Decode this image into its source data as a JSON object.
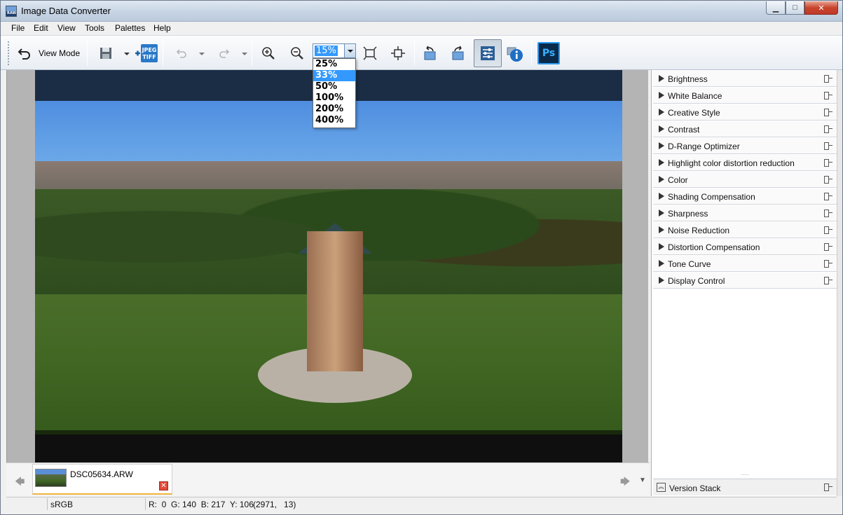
{
  "window": {
    "title": "Image Data Converter",
    "app_icon_text": "RAW",
    "minimize_glyph": "▁",
    "maximize_glyph": "□",
    "close_glyph": "✕"
  },
  "menu": [
    "File",
    "Edit",
    "View",
    "Tools",
    "Palettes",
    "Help"
  ],
  "toolbar": {
    "view_mode_label": "View Mode",
    "jpeg_tiff_icon_text": [
      "JPEG",
      "TIFF"
    ],
    "ps_icon_text": "Ps",
    "zoom": {
      "value": "15%",
      "options": [
        "25%",
        "33%",
        "50%",
        "100%",
        "200%",
        "400%"
      ],
      "highlighted": "33%"
    }
  },
  "filmstrip": {
    "file_name": "DSC05634.ARW",
    "prev_glyph": "🡄",
    "next_glyph": "🡆",
    "more_glyph": "▼",
    "delete_glyph": "✕"
  },
  "palette": {
    "sections": [
      "Brightness",
      "White Balance",
      "Creative Style",
      "Contrast",
      "D-Range Optimizer",
      "Highlight color distortion reduction",
      "Color",
      "Shading Compensation",
      "Sharpness",
      "Noise Reduction",
      "Distortion Compensation",
      "Tone Curve",
      "Display Control"
    ],
    "resize_grip": ".....",
    "version_stack_label": "Version Stack",
    "version_icon_glyph": "︽"
  },
  "status": {
    "color_space": "sRGB",
    "pixel_info": "R:  0  G: 140  B: 217  Y: 106",
    "coordinates": "(2971,   13)"
  },
  "colors": {
    "highlight": "#3399ff",
    "accent_orange": "#f2b33d",
    "close_red": "#c8452b"
  }
}
